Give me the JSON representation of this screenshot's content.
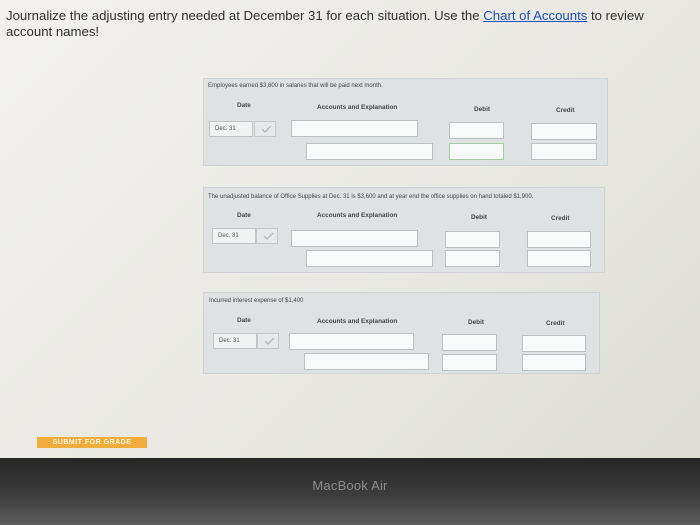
{
  "instructions": {
    "text_before": "Journalize the adjusting entry needed at December 31 for each situation. Use the ",
    "link": "Chart of Accounts",
    "text_after": " to review account names!"
  },
  "entries": [
    {
      "prompt": "Employees earned $3,600 in salaries that will be paid next month.",
      "headers": {
        "date": "Date",
        "accounts": "Accounts and Explanation",
        "debit": "Debit",
        "credit": "Credit"
      },
      "date": "Dec. 31"
    },
    {
      "prompt": "The unadjusted balance of Office Supplies at Dec. 31 is $3,600 and at year end the office supplies on hand totaled $1,900.",
      "headers": {
        "date": "Date",
        "accounts": "Accounts and Explanation",
        "debit": "Debit",
        "credit": "Credit"
      },
      "date": "Dec. 31"
    },
    {
      "prompt": "Incurred interest expense of $1,400",
      "headers": {
        "date": "Date",
        "accounts": "Accounts and Explanation",
        "debit": "Debit",
        "credit": "Credit"
      },
      "date": "Dec. 31"
    }
  ],
  "submit_label": "SUBMIT FOR GRADE",
  "bezel_brand": "MacBook Air",
  "colors": {
    "link": "#1c4fb4",
    "submit_bg": "#f0ad3c",
    "card_bg": "#dfe2e3"
  }
}
